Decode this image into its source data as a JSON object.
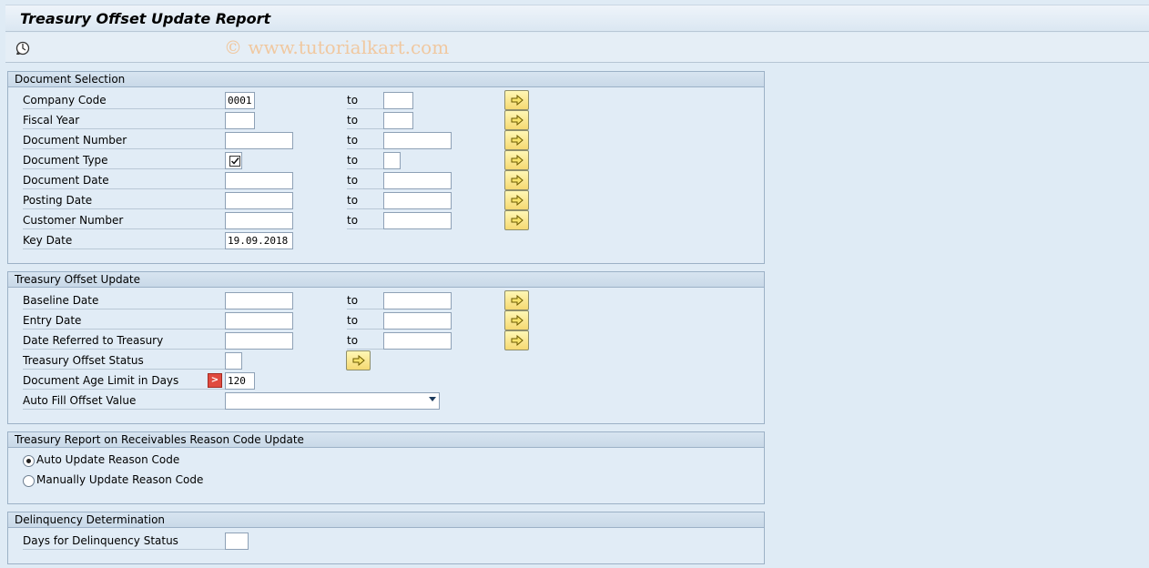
{
  "title": "Treasury Offset Update Report",
  "watermark": "© www.tutorialkart.com",
  "to_label": "to",
  "doc_selection": {
    "header": "Document Selection",
    "rows": [
      {
        "label": "Company Code",
        "from": "0001",
        "to": ""
      },
      {
        "label": "Fiscal Year",
        "from": "",
        "to": ""
      },
      {
        "label": "Document Number",
        "from": "",
        "to": ""
      },
      {
        "label": "Document Type",
        "from": "",
        "to": ""
      },
      {
        "label": "Document Date",
        "from": "",
        "to": ""
      },
      {
        "label": "Posting Date",
        "from": "",
        "to": ""
      },
      {
        "label": "Customer Number",
        "from": "",
        "to": ""
      },
      {
        "label": "Key Date",
        "from": "19.09.2018"
      }
    ]
  },
  "treasury_update": {
    "header": "Treasury Offset Update",
    "rows": [
      {
        "label": "Baseline Date",
        "from": "",
        "to": ""
      },
      {
        "label": "Entry Date",
        "from": "",
        "to": ""
      },
      {
        "label": "Date Referred to Treasury",
        "from": "",
        "to": ""
      },
      {
        "label": "Treasury Offset Status",
        "from": ""
      },
      {
        "label": "Document Age Limit in Days",
        "from": "120"
      },
      {
        "label": "Auto Fill Offset Value",
        "from": ""
      }
    ]
  },
  "reason_code": {
    "header": "Treasury Report on Receivables Reason Code Update",
    "options": [
      {
        "label": "Auto Update Reason Code",
        "selected": true
      },
      {
        "label": "Manually Update Reason Code",
        "selected": false
      }
    ]
  },
  "delinquency": {
    "header": "Delinquency Determination",
    "rows": [
      {
        "label": "Days for Delinquency Status",
        "from": ""
      }
    ]
  }
}
